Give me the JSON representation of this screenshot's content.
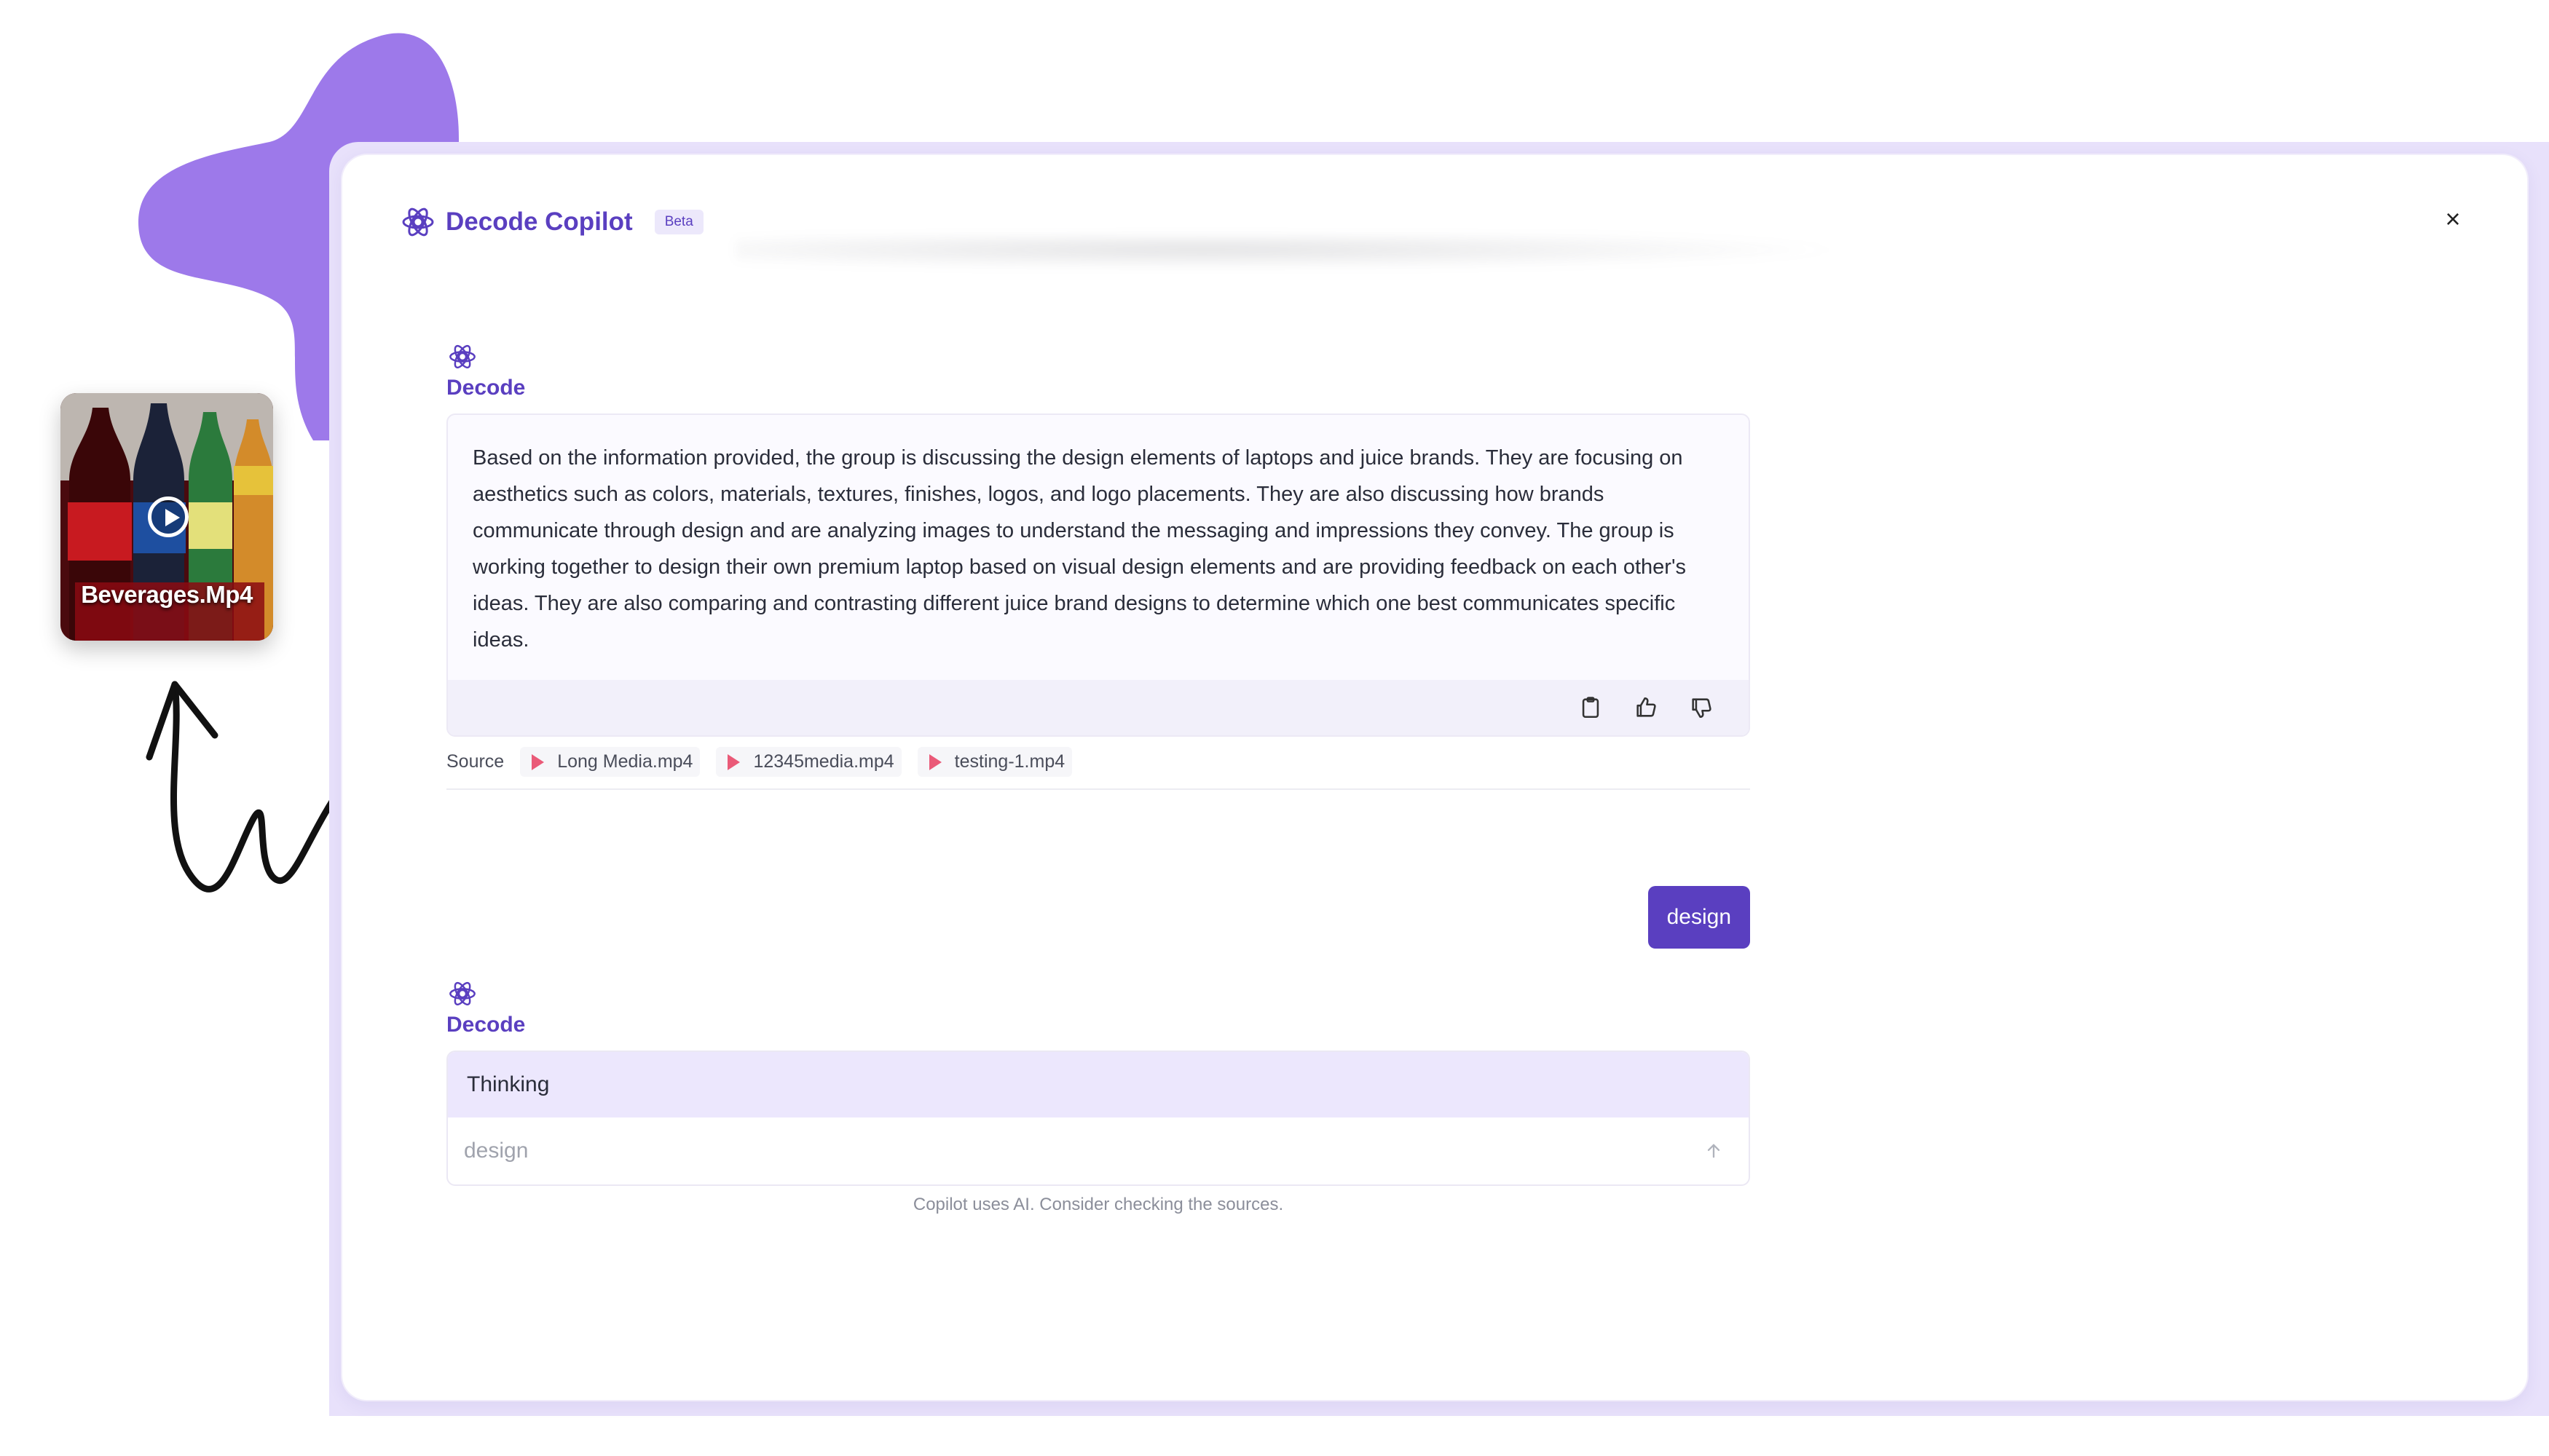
{
  "app": {
    "title": "Decode Copilot",
    "badge": "Beta",
    "close_label": "×"
  },
  "thumbnail": {
    "label": "Beverages.Mp4"
  },
  "conversation": {
    "messages": [
      {
        "role": "bot",
        "name": "Decode",
        "text": "Based on the information provided, the group is discussing the design elements of laptops and juice brands. They are focusing on aesthetics such as colors, materials, textures, finishes, logos, and logo placements. They are also discussing how brands communicate through design and are analyzing images to understand the messaging and impressions they convey. The group is working together to design their own premium laptop based on visual design elements and are providing feedback on each other's ideas. They are also comparing and contrasting different juice brand designs to determine which one best communicates specific ideas.",
        "sources_label": "Source",
        "sources": [
          "Long Media.mp4",
          "12345media.mp4",
          "testing-1.mp4"
        ]
      },
      {
        "role": "user",
        "text": "design"
      },
      {
        "role": "bot",
        "name": "Decode",
        "status": "Thinking"
      }
    ]
  },
  "composer": {
    "value": "design"
  },
  "footer": {
    "disclaimer": "Copilot uses AI. Consider checking the sources."
  },
  "colors": {
    "accent": "#5a3fc0",
    "blob": "#9d79ea",
    "frame": "#e8e1fb",
    "thinking_bg": "#ece7fd",
    "source_play": "#ea5a78"
  },
  "icons": {
    "brand": "atom-gear-icon",
    "copy": "clipboard-icon",
    "like": "thumbs-up-icon",
    "dislike": "thumbs-down-icon",
    "send": "arrow-up-icon",
    "close": "close-icon",
    "play": "play-icon"
  }
}
